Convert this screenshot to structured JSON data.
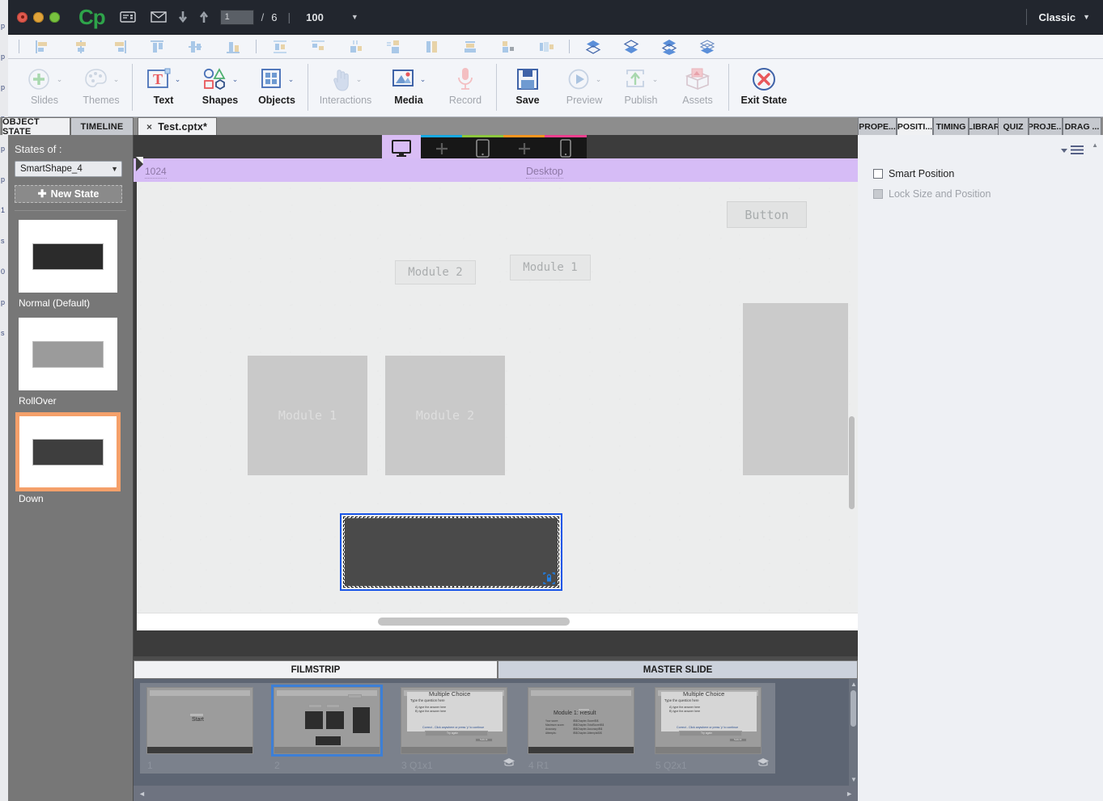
{
  "titlebar": {
    "app_initials": "Cp",
    "page_current": "1",
    "page_sep": "/",
    "page_total": "6",
    "divider": "|",
    "zoom": "100",
    "zoom_caret": "▼",
    "workspace": "Classic",
    "workspace_caret": "▼",
    "icons": {
      "presentation": "presentation-icon",
      "mail": "mail-icon",
      "down": "move-down-icon",
      "up": "move-up-icon"
    }
  },
  "align_toolbar": {
    "items": [
      {
        "name": "align-left",
        "label": "Align Left"
      },
      {
        "name": "align-center",
        "label": "Align Center"
      },
      {
        "name": "align-right",
        "label": "Align Right"
      },
      {
        "name": "align-top",
        "label": "Align Top"
      },
      {
        "name": "align-middle",
        "label": "Align Middle"
      },
      {
        "name": "align-bottom",
        "label": "Align Bottom"
      },
      {
        "name": "distribute-horizontally",
        "label": "Distribute Horizontally"
      },
      {
        "name": "distribute-vertically",
        "label": "Distribute Vertically"
      },
      {
        "name": "resize-width",
        "label": "Resize to Same Width"
      },
      {
        "name": "resize-height",
        "label": "Resize to Same Height"
      },
      {
        "name": "resize-both",
        "label": "Resize to Same Size"
      },
      {
        "name": "group-objects",
        "label": "Group"
      },
      {
        "name": "ungroup-objects",
        "label": "Ungroup"
      },
      {
        "name": "align-to-slide",
        "label": "Align to Slide"
      }
    ],
    "arrange": [
      {
        "name": "bring-to-front",
        "label": "Bring to Front"
      },
      {
        "name": "bring-forward",
        "label": "Bring Forward"
      },
      {
        "name": "send-backward",
        "label": "Send Backward"
      },
      {
        "name": "send-to-back",
        "label": "Send to Back"
      }
    ]
  },
  "ribbon": {
    "items": [
      {
        "label": "Slides",
        "icon": "plus-circle-icon",
        "enabled": false,
        "caret": true
      },
      {
        "label": "Themes",
        "icon": "palette-icon",
        "enabled": false,
        "caret": true
      },
      {
        "label": "Text",
        "icon": "text-box-icon",
        "enabled": true,
        "caret": true
      },
      {
        "label": "Shapes",
        "icon": "shapes-icon",
        "enabled": true,
        "caret": true
      },
      {
        "label": "Objects",
        "icon": "objects-grid-icon",
        "enabled": true,
        "caret": true
      },
      {
        "label": "Interactions",
        "icon": "hand-pointer-icon",
        "enabled": false,
        "caret": true
      },
      {
        "label": "Media",
        "icon": "image-icon",
        "enabled": true,
        "caret": true
      },
      {
        "label": "Record",
        "icon": "microphone-icon",
        "enabled": false,
        "caret": false
      },
      {
        "label": "Save",
        "icon": "floppy-disk-icon",
        "enabled": true,
        "caret": false
      },
      {
        "label": "Preview",
        "icon": "play-circle-icon",
        "enabled": false,
        "caret": true
      },
      {
        "label": "Publish",
        "icon": "publish-upload-icon",
        "enabled": false,
        "caret": true
      },
      {
        "label": "Assets",
        "icon": "assets-box-icon",
        "enabled": false,
        "caret": false
      },
      {
        "label": "Exit State",
        "icon": "exit-x-circle-icon",
        "enabled": true,
        "caret": false
      }
    ]
  },
  "left_tabs": [
    {
      "label": "OBJECT STATE",
      "active": true
    },
    {
      "label": "TIMELINE",
      "active": false
    }
  ],
  "document_tab": {
    "close_glyph": "×",
    "label": "Test.cptx*"
  },
  "right_tabs": [
    {
      "label": "PROPE...",
      "active": false
    },
    {
      "label": "POSITI...",
      "active": true
    },
    {
      "label": "TIMING",
      "active": false
    },
    {
      "label": "LIBRAR...",
      "active": false
    },
    {
      "label": "QUIZ",
      "active": false
    },
    {
      "label": "PROJE...",
      "active": false
    },
    {
      "label": "DRAG ...",
      "active": false
    }
  ],
  "object_state_panel": {
    "heading": "States of :",
    "selected_object": "SmartShape_4",
    "dropdown_caret": "▼",
    "new_state_label": "New State",
    "new_state_plus": "✚",
    "states": [
      {
        "name": "Normal (Default)",
        "fill": "dark",
        "selected": false
      },
      {
        "name": "RollOver",
        "fill": "mid",
        "selected": false
      },
      {
        "name": "Down",
        "fill": "down",
        "selected": true
      }
    ]
  },
  "canvas": {
    "devices": [
      {
        "name": "desktop-view",
        "icon": "monitor-icon",
        "active": true,
        "accent": ""
      },
      {
        "name": "add-breakpoint-1",
        "icon": "plus-icon",
        "active": false,
        "accent": "#18a8e0"
      },
      {
        "name": "tablet-view",
        "icon": "tablet-icon",
        "active": false,
        "accent": "#8cc63e"
      },
      {
        "name": "add-breakpoint-2",
        "icon": "plus-icon",
        "active": false,
        "accent": "#f7941e"
      },
      {
        "name": "mobile-view",
        "icon": "phone-icon",
        "active": false,
        "accent": "#ec3f8e"
      }
    ],
    "breakpoint_width": "1024",
    "breakpoint_name": "Desktop",
    "objects": [
      {
        "name": "canvas-button-shape",
        "text": "Button",
        "type": "button"
      },
      {
        "name": "canvas-label-module2",
        "text": "Module 2",
        "type": "label"
      },
      {
        "name": "canvas-label-module1",
        "text": "Module 1",
        "type": "label"
      },
      {
        "name": "canvas-box-module1",
        "text": "Module 1",
        "type": "box"
      },
      {
        "name": "canvas-box-module2",
        "text": "Module 2",
        "type": "box"
      },
      {
        "name": "canvas-box-blank",
        "text": "",
        "type": "blank"
      },
      {
        "name": "canvas-smartshape-4",
        "text": "",
        "type": "selected"
      }
    ]
  },
  "filmstrip": {
    "tabs": [
      {
        "label": "FILMSTRIP",
        "active": true
      },
      {
        "label": "MASTER SLIDE",
        "active": false
      }
    ],
    "slides": [
      {
        "number": "1",
        "title": "",
        "label": "1",
        "thumb_text": "Start",
        "selected": false,
        "quiz": false
      },
      {
        "number": "2",
        "title": "",
        "label": "2",
        "thumb_text": "",
        "selected": true,
        "quiz": false
      },
      {
        "number": "3",
        "title": "Q1x1",
        "label": "3 Q1x1",
        "thumb_text": "Multiple Choice",
        "selected": false,
        "quiz": true
      },
      {
        "number": "4",
        "title": "R1",
        "label": "4 R1",
        "thumb_text": "Module 1: Result",
        "selected": false,
        "quiz": false
      },
      {
        "number": "5",
        "title": "Q2x1",
        "label": "5 Q2x1",
        "thumb_text": "Multiple Choice",
        "selected": false,
        "quiz": true
      }
    ],
    "thumb_details": {
      "question_prompt": "Type the question here",
      "answer_a": "A) type the answer here",
      "answer_b": "B) type the answer here",
      "correct_msg": "Correct - Click anywhere or press 'y' to continue",
      "retry_label": "Try again",
      "submit_label": "Submit",
      "result_rows": [
        {
          "k": "Your score:",
          "v": "\\$\\$Chapter-Score\\$\\$"
        },
        {
          "k": "Maximum score:",
          "v": "\\$\\$Chapter-TotalScore\\$\\$"
        },
        {
          "k": "Accuracy:",
          "v": "\\$\\$Chapter-Accuracy\\$\\$"
        },
        {
          "k": "Attempts:",
          "v": "\\$\\$Chapter-Attempts\\$\\$"
        }
      ]
    },
    "scroll_up": "▲",
    "scroll_down": "▼",
    "nav_left": "◄",
    "nav_right": "►"
  },
  "position_panel": {
    "menu_icon": "panel-menu-icon",
    "scroll_up": "▲",
    "options": [
      {
        "label": "Smart Position",
        "checked": false,
        "disabled": false
      },
      {
        "label": "Lock Size and Position",
        "checked": false,
        "disabled": true
      }
    ]
  },
  "ghost_window_lines": [
    "p",
    "p",
    "p",
    "p",
    "p",
    "p",
    "1",
    "",
    "",
    "",
    "",
    "s",
    "0",
    "p",
    "",
    "",
    "",
    "",
    "",
    "",
    "",
    "",
    "",
    "s",
    ""
  ]
}
